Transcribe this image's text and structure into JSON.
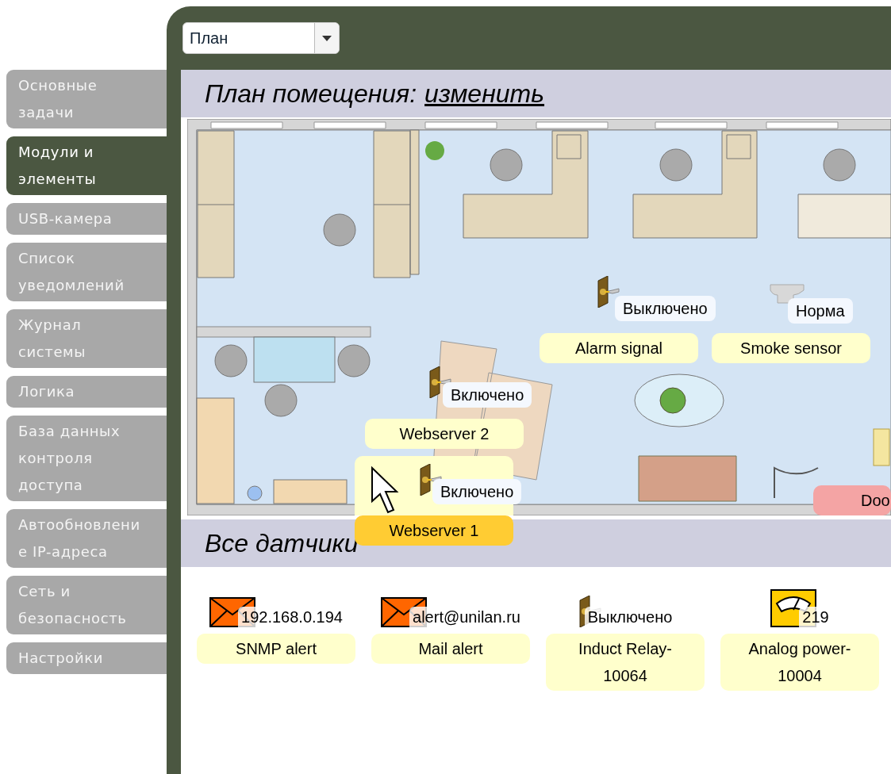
{
  "sidebar": {
    "items": [
      {
        "label": "Основные задачи",
        "selected": false
      },
      {
        "label": "Модули и элементы",
        "selected": true
      },
      {
        "label": "USB-камера",
        "selected": false
      },
      {
        "label": "Список уведомлений",
        "selected": false
      },
      {
        "label": "Журнал системы",
        "selected": false
      },
      {
        "label": "Логика",
        "selected": false
      },
      {
        "label": "База данных контроля доступа",
        "selected": false
      },
      {
        "label": "Автообновление IP-адреса",
        "selected": false
      },
      {
        "label": "Сеть и безопасность",
        "selected": false
      },
      {
        "label": "Настройки",
        "selected": false
      }
    ]
  },
  "view_select": {
    "value": "План"
  },
  "plan": {
    "title": "План помещения:",
    "link": "изменить",
    "devices": [
      {
        "kind": "socket",
        "status": "Выключено",
        "name": "Alarm signal",
        "selected": false,
        "alarm": false
      },
      {
        "kind": "smoke",
        "status": "Норма",
        "name": "Smoke sensor",
        "selected": false,
        "alarm": false
      },
      {
        "kind": "socket",
        "status": "Включено",
        "name": "Webserver 2",
        "selected": false,
        "alarm": false
      },
      {
        "kind": "socket",
        "status": "Включено",
        "name": "Webserver 1",
        "selected": true,
        "alarm": false
      },
      {
        "kind": "door",
        "name": "Doo",
        "selected": false,
        "alarm": true
      }
    ]
  },
  "sensors": {
    "title": "Все датчики",
    "items": [
      {
        "kind": "envelope",
        "value": "192.168.0.194",
        "name": "SNMP alert"
      },
      {
        "kind": "envelope",
        "value": "alert@unilan.ru",
        "name": "Mail alert"
      },
      {
        "kind": "socket",
        "value": "Выключено",
        "name": "Induct Relay-10064"
      },
      {
        "kind": "gauge",
        "value": "219",
        "name": "Analog power-10004"
      }
    ]
  }
}
